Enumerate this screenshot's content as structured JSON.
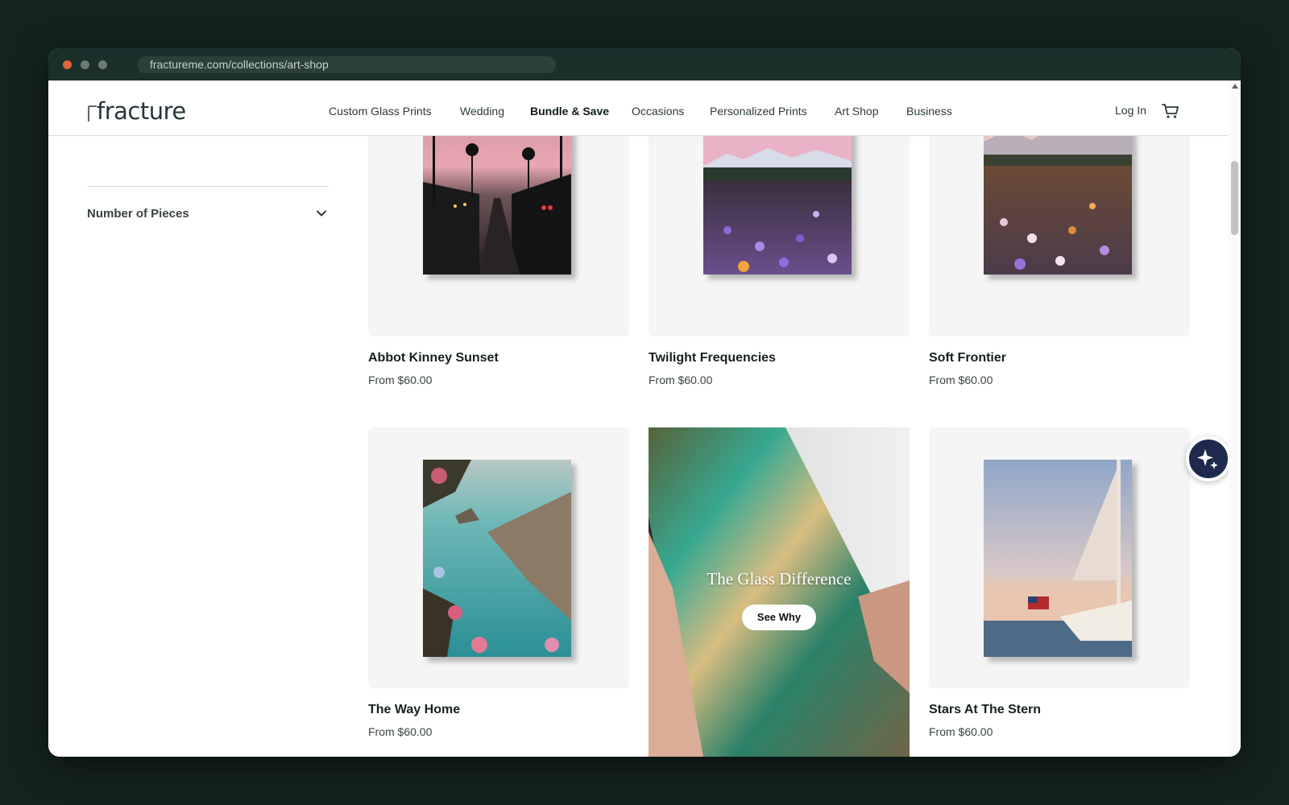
{
  "browser": {
    "url": "fractureme.com/collections/art-shop"
  },
  "header": {
    "logo_text": "fracture",
    "nav": [
      {
        "label": "Custom Glass Prints",
        "bold": false
      },
      {
        "label": "Wedding",
        "bold": false
      },
      {
        "label": "Bundle & Save",
        "bold": true
      },
      {
        "label": "Occasions",
        "bold": false
      },
      {
        "label": "Personalized Prints",
        "bold": false
      },
      {
        "label": "Art Shop",
        "bold": false
      },
      {
        "label": "Business",
        "bold": false
      }
    ],
    "login_label": "Log In",
    "cart_icon": "cart-icon"
  },
  "sidebar": {
    "filter_label": "Number of Pieces",
    "filter_icon": "chevron-down-icon"
  },
  "products": [
    {
      "title": "Abbot Kinney Sunset",
      "price": "From $60.00"
    },
    {
      "title": "Twilight Frequencies",
      "price": "From $60.00"
    },
    {
      "title": "Soft Frontier",
      "price": "From $60.00"
    },
    {
      "title": "The Way Home",
      "price": "From $60.00"
    },
    {
      "title": "Stars At The Stern",
      "price": "From $60.00"
    }
  ],
  "promo": {
    "title": "The Glass Difference",
    "button_label": "See Why"
  },
  "assistant": {
    "icon": "sparkle-icon"
  },
  "colors": {
    "page_bg": "#142320",
    "chrome_bg": "#1b2f2b",
    "assistant_bg": "#1d2a4d",
    "tile_bg": "#f5f5f5"
  }
}
